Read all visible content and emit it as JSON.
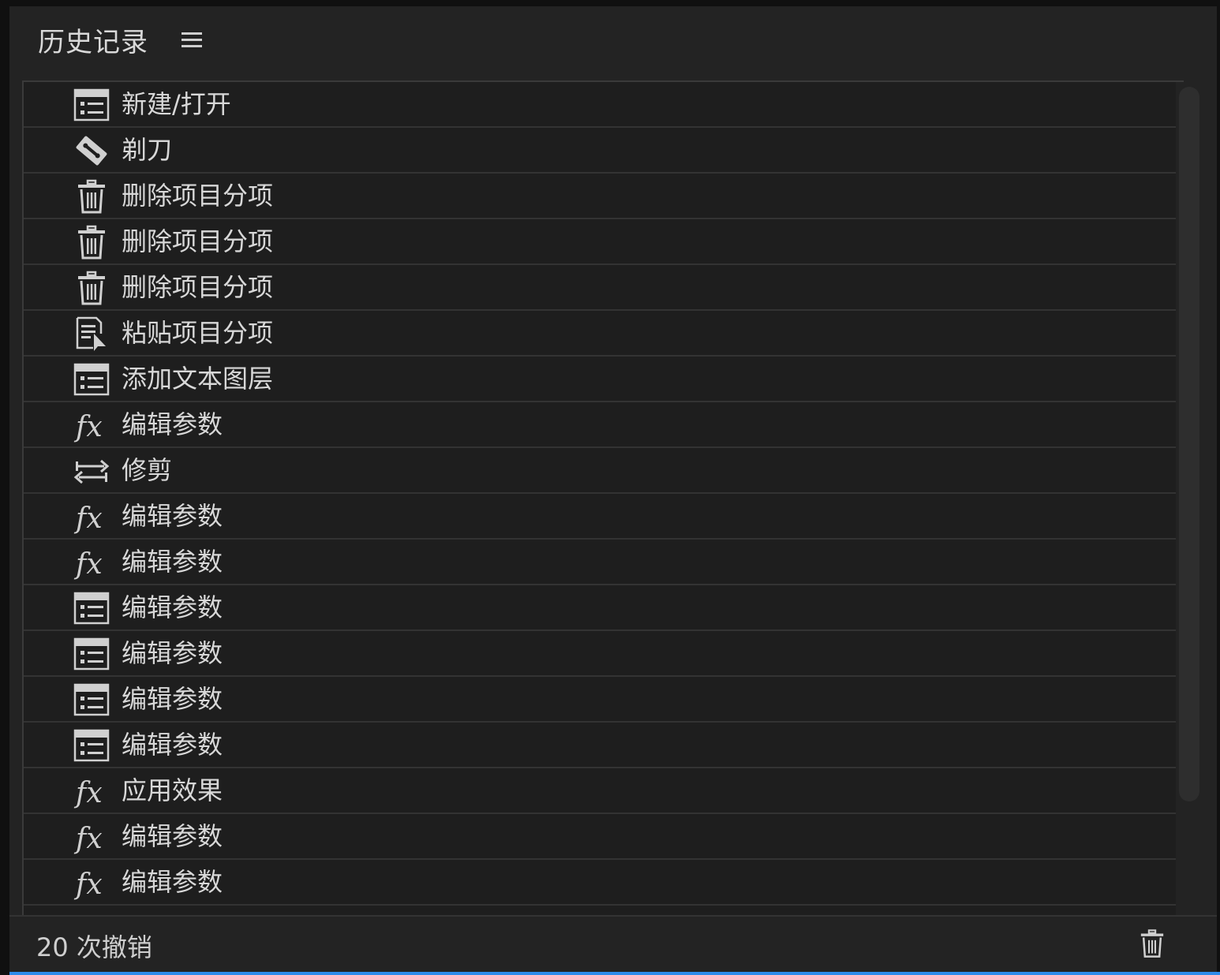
{
  "header": {
    "title": "历史记录",
    "menu_icon": "hamburger-menu-icon"
  },
  "history": [
    {
      "icon": "list-document",
      "label": "新建/打开"
    },
    {
      "icon": "razor-blade",
      "label": "剃刀"
    },
    {
      "icon": "trash",
      "label": "删除项目分项"
    },
    {
      "icon": "trash",
      "label": "删除项目分项"
    },
    {
      "icon": "trash",
      "label": "删除项目分项"
    },
    {
      "icon": "paste-document",
      "label": "粘贴项目分项"
    },
    {
      "icon": "list-document",
      "label": "添加文本图层"
    },
    {
      "icon": "fx",
      "label": "编辑参数"
    },
    {
      "icon": "trim-arrows",
      "label": "修剪"
    },
    {
      "icon": "fx",
      "label": "编辑参数"
    },
    {
      "icon": "fx",
      "label": "编辑参数"
    },
    {
      "icon": "list-document",
      "label": "编辑参数"
    },
    {
      "icon": "list-document",
      "label": "编辑参数"
    },
    {
      "icon": "list-document",
      "label": "编辑参数"
    },
    {
      "icon": "list-document",
      "label": "编辑参数"
    },
    {
      "icon": "fx",
      "label": "应用效果"
    },
    {
      "icon": "fx",
      "label": "编辑参数"
    },
    {
      "icon": "fx",
      "label": "编辑参数"
    }
  ],
  "footer": {
    "undo_count": "20 次撤销",
    "delete_icon": "trash-icon"
  },
  "colors": {
    "panel_bg": "#232323",
    "list_bg": "#1e1e1e",
    "text": "#d8d8d8",
    "accent_strip": "#2d8ceb"
  }
}
